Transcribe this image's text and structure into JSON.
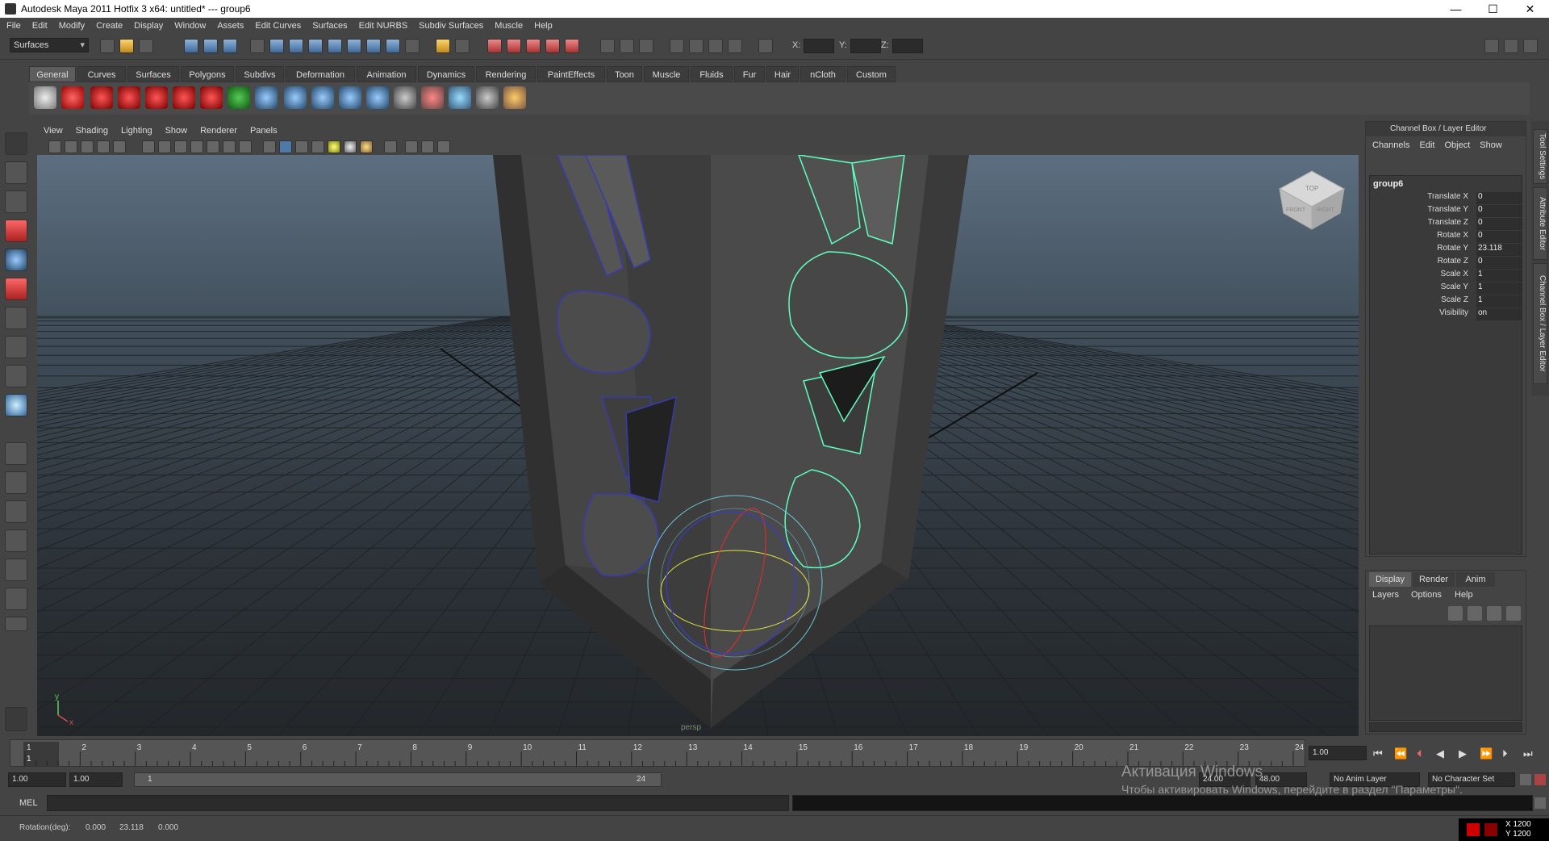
{
  "window": {
    "title": "Autodesk Maya 2011 Hotfix 3 x64: untitled*   ---   group6",
    "min": "—",
    "max": "☐",
    "close": "✕"
  },
  "menubar": [
    "File",
    "Edit",
    "Modify",
    "Create",
    "Display",
    "Window",
    "Assets",
    "Edit Curves",
    "Surfaces",
    "Edit NURBS",
    "Subdiv Surfaces",
    "Muscle",
    "Help"
  ],
  "status": {
    "menuset": "Surfaces",
    "x_label": "X:",
    "y_label": "Y:",
    "z_label": "Z:"
  },
  "shelf_tabs": [
    "General",
    "Curves",
    "Surfaces",
    "Polygons",
    "Subdivs",
    "Deformation",
    "Animation",
    "Dynamics",
    "Rendering",
    "PaintEffects",
    "Toon",
    "Muscle",
    "Fluids",
    "Fur",
    "Hair",
    "nCloth",
    "Custom"
  ],
  "viewport": {
    "menu": [
      "View",
      "Shading",
      "Lighting",
      "Show",
      "Renderer",
      "Panels"
    ],
    "camera_label": "persp",
    "cube_top": "TOP",
    "cube_front": "FRONT",
    "cube_right": "RIGHT",
    "axis_x": "x",
    "axis_y": "y"
  },
  "channelbox": {
    "title": "Channel Box / Layer Editor",
    "menu": [
      "Channels",
      "Edit",
      "Object",
      "Show"
    ],
    "object": "group6",
    "channels": [
      {
        "name": "Translate X",
        "value": "0"
      },
      {
        "name": "Translate Y",
        "value": "0"
      },
      {
        "name": "Translate Z",
        "value": "0"
      },
      {
        "name": "Rotate X",
        "value": "0"
      },
      {
        "name": "Rotate Y",
        "value": "23.118"
      },
      {
        "name": "Rotate Z",
        "value": "0"
      },
      {
        "name": "Scale X",
        "value": "1"
      },
      {
        "name": "Scale Y",
        "value": "1"
      },
      {
        "name": "Scale Z",
        "value": "1"
      },
      {
        "name": "Visibility",
        "value": "on"
      }
    ]
  },
  "layers": {
    "tabs": [
      "Display",
      "Render",
      "Anim"
    ],
    "menu": [
      "Layers",
      "Options",
      "Help"
    ]
  },
  "side_tabs": [
    "Tool Settings",
    "Attribute Editor",
    "Channel Box / Layer Editor"
  ],
  "timeline": {
    "ticks": [
      "1",
      "2",
      "3",
      "4",
      "5",
      "6",
      "7",
      "8",
      "9",
      "10",
      "11",
      "12",
      "13",
      "14",
      "15",
      "16",
      "17",
      "18",
      "19",
      "20",
      "21",
      "22",
      "23",
      "24"
    ],
    "current_frame": "1",
    "current_time_field": "1.00"
  },
  "range": {
    "start_time": "1.00",
    "playback_start": "1.00",
    "range_start": "1",
    "range_end": "24",
    "playback_end": "24.00",
    "end_time": "48.00",
    "anim_layer": "No Anim Layer",
    "char_set": "No Character Set"
  },
  "mel": {
    "label": "MEL"
  },
  "helpline": {
    "text": "Rotation(deg):",
    "v1": "0.000",
    "v2": "23.118",
    "v3": "0.000"
  },
  "tray": {
    "x": "X 1200",
    "y": "Y 1200"
  },
  "watermark": {
    "line1": "Активация Windows",
    "line2": "Чтобы активировать Windows, перейдите в раздел \"Параметры\"."
  },
  "colors": {
    "selection": "#5effc0",
    "wireframe": "#3a3ab0",
    "bg_top": "#5c6e80"
  }
}
